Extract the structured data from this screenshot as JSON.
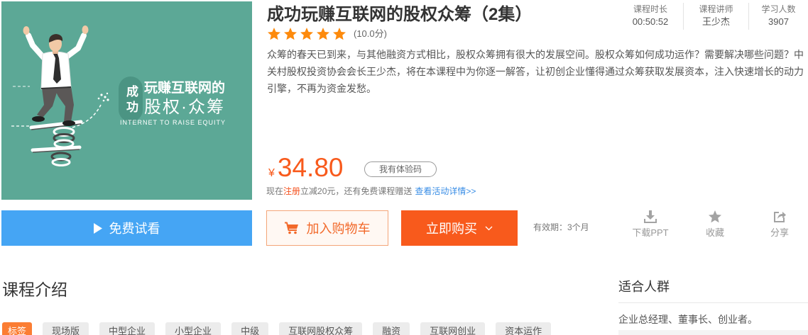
{
  "course": {
    "title": "成功玩赚互联网的股权众筹（2集）",
    "rating_stars": 5,
    "rating_text": "(10.0分)",
    "description": "众筹的春天已到来，与其他融资方式相比，股权众筹拥有很大的发展空间。股权众筹如何成功运作？需要解决哪些问题？中关村股权投资协会会长王少杰，将在本课程中为你逐一解答，让初创企业懂得通过众筹获取发展资本，注入快速增长的动力引擎，不再为资金发愁。",
    "cover": {
      "badge": "成功",
      "headline": "玩赚互联网的",
      "subheadline": "股权·众筹",
      "tagline": "INTERNET TO RAISE EQUITY"
    }
  },
  "stats": [
    {
      "label": "课程时长",
      "value": "00:50:52"
    },
    {
      "label": "课程讲师",
      "value": "王少杰"
    },
    {
      "label": "学习人数",
      "value": "3907"
    }
  ],
  "price": {
    "currency": "¥",
    "amount": "34.80",
    "coupon_button": "我有体验码"
  },
  "promo": {
    "prefix": "现在",
    "register_link": "注册",
    "middle": "立减20元，还有免费课程赠送",
    "details_link": "查看活动详情>>"
  },
  "actions": {
    "free_preview": "免费试看",
    "add_to_cart": "加入购物车",
    "buy_now": "立即购买",
    "validity": "有效期：3个月",
    "download": "下载PPT",
    "favorite": "收藏",
    "share": "分享"
  },
  "intro": {
    "heading": "课程介绍",
    "tags_label": "标签",
    "tags": [
      "现场版",
      "中型企业",
      "小型企业",
      "中级",
      "互联网股权众筹",
      "融资",
      "互联网创业",
      "资本运作"
    ]
  },
  "audience": {
    "heading": "适合人群",
    "text": "企业总经理、董事长、创业者。"
  },
  "icons": {
    "preview": "play-icon",
    "cart": "cart-icon",
    "buy_dropdown": "chevron-down-icon",
    "download": "download-icon",
    "favorite": "star-icon",
    "share": "share-icon",
    "rating": "star-icon"
  },
  "colors": {
    "accent": "#f85a1c",
    "preview_button": "#45a5f4",
    "star": "#fd8a0c",
    "cover_background": "#5ca896",
    "tag_label": "#fb7d33",
    "link_blue": "#3a8ee6"
  }
}
